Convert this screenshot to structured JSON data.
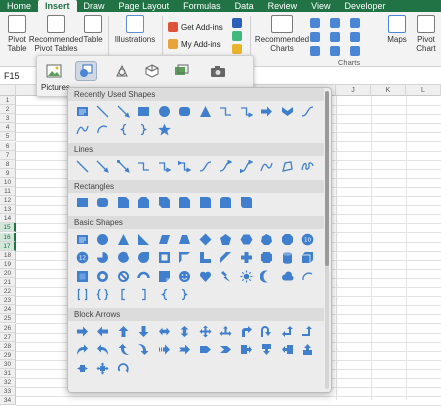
{
  "ribbon_tabs": [
    "Home",
    "Insert",
    "Draw",
    "Page Layout",
    "Formulas",
    "Data",
    "Review",
    "View",
    "Developer"
  ],
  "ribbon": {
    "pivot_table": "Pivot Table",
    "recommended_pivot": "Recommended Pivot Tables",
    "table": "Table",
    "illustrations": "Illustrations",
    "get_addins": "Get Add-ins",
    "my_addins": "My Add-ins",
    "recommended_charts": "Recommended Charts",
    "maps": "Maps",
    "pivot_chart": "Pivot Chart",
    "charts_group": "Charts"
  },
  "formula_bar": {
    "name_box": "F15"
  },
  "illustrations_toolbar": {
    "pictures": "Pictures"
  },
  "columns": [
    "",
    "J",
    "K",
    "L"
  ],
  "rows": [
    "1",
    "2",
    "3",
    "4",
    "5",
    "6",
    "7",
    "8",
    "9",
    "10",
    "11",
    "12",
    "13",
    "14",
    "15",
    "16",
    "17",
    "18",
    "19",
    "20",
    "21",
    "22",
    "23",
    "24",
    "25",
    "26",
    "27",
    "28",
    "29",
    "30",
    "31",
    "32",
    "33",
    "34"
  ],
  "shapes_panel": {
    "sections": [
      {
        "title": "Recently Used Shapes",
        "shapes": [
          "text-box",
          "line",
          "arrow-line",
          "rectangle",
          "oval",
          "rounded-rectangle",
          "triangle",
          "elbow-connector",
          "elbow-arrow-connector",
          "right-arrow",
          "chevron-down",
          "curved-connector",
          "curve",
          "arc",
          "left-brace",
          "right-brace",
          "star"
        ]
      },
      {
        "title": "Lines",
        "shapes": [
          "line",
          "arrow-line",
          "double-arrow-line",
          "elbow-connector",
          "elbow-arrow-connector",
          "elbow-double-arrow-connector",
          "curved-connector",
          "curved-arrow-connector",
          "curved-double-arrow-connector",
          "curve",
          "freeform",
          "scribble"
        ]
      },
      {
        "title": "Rectangles",
        "shapes": [
          "rectangle",
          "rounded-rectangle",
          "snip-single-corner",
          "snip-same-side",
          "snip-diagonal",
          "snip-round-single",
          "round-single-corner",
          "round-same-side",
          "round-diagonal"
        ]
      },
      {
        "title": "Basic Shapes",
        "shapes": [
          "text-box",
          "oval",
          "triangle",
          "right-triangle",
          "parallelogram",
          "trapezoid",
          "diamond",
          "pentagon",
          "hexagon",
          "heptagon",
          "octagon",
          "decagon",
          "dodecagon",
          "pie",
          "chord",
          "teardrop",
          "frame",
          "half-frame",
          "l-shape",
          "diagonal-stripe",
          "cross",
          "plaque",
          "can",
          "cube",
          "bevel",
          "donut",
          "no-symbol",
          "block-arc",
          "folded-corner",
          "smiley-face",
          "heart",
          "lightning-bolt",
          "sun",
          "moon",
          "cloud",
          "arc",
          "double-bracket",
          "double-brace",
          "left-bracket",
          "right-bracket",
          "left-brace",
          "right-brace"
        ]
      },
      {
        "title": "Block Arrows",
        "shapes": [
          "right-arrow",
          "left-arrow",
          "up-arrow",
          "down-arrow",
          "left-right-arrow",
          "up-down-arrow",
          "quad-arrow",
          "left-right-up-arrow",
          "bent-arrow",
          "u-turn-arrow",
          "left-up-arrow",
          "bent-up-arrow",
          "curved-right-arrow",
          "curved-left-arrow",
          "curved-up-arrow",
          "curved-down-arrow",
          "striped-right-arrow",
          "notched-right-arrow",
          "pentagon-arrow",
          "chevron-arrow",
          "right-arrow-callout",
          "down-arrow-callout",
          "left-arrow-callout",
          "up-arrow-callout",
          "left-right-arrow-callout",
          "quad-arrow-callout",
          "circular-arrow"
        ]
      }
    ]
  },
  "colors": {
    "excel_green": "#217346",
    "shape_blue": "#3f7fce"
  }
}
